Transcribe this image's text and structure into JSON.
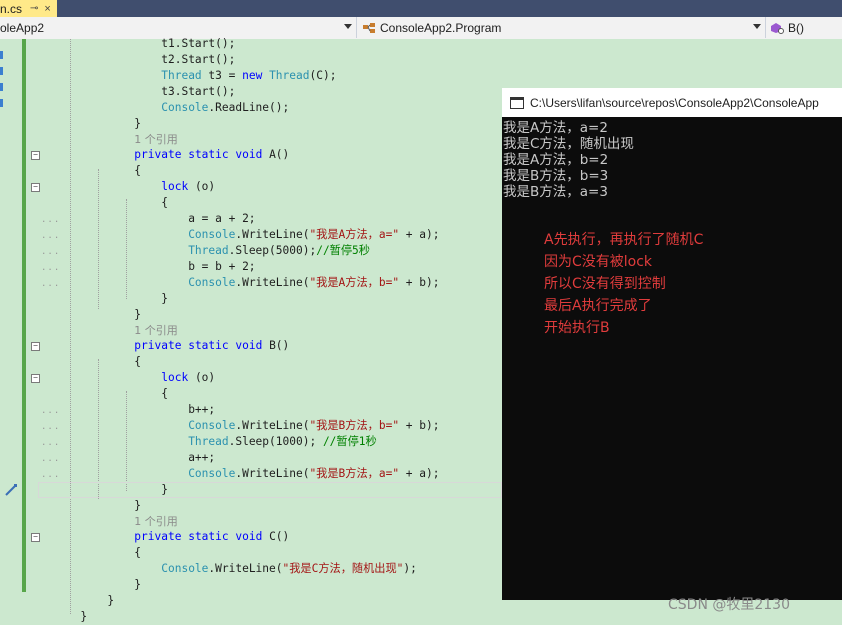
{
  "tab": {
    "label": "n.cs",
    "pin": "⊸",
    "close": "×"
  },
  "nav": {
    "project": "oleApp2",
    "class": "ConsoleApp2.Program",
    "member": "B()"
  },
  "code": {
    "t1_start": [
      "t1",
      ".",
      "Start",
      "();"
    ],
    "ref_label": "1 个引用",
    "lines": {
      "l1": "t1.Start();",
      "l2": "t2.Start();",
      "l4": "t3.Start();",
      "a_line1": "a = a + 2;",
      "b_line1": "b = b + 2;",
      "bpp": "b++;",
      "app": "a++;"
    },
    "strings": {
      "a_eq_a": "\"我是A方法，a=\"",
      "a_eq_b": "\"我是A方法，b=\"",
      "b_eq_b": "\"我是B方法，b=\"",
      "b_eq_a": "\"我是B方法，a=\"",
      "c_str": "\"我是C方法，随机出现\""
    },
    "comments": {
      "sleep5": "//暂停5秒",
      "sleep1": "//暂停1秒"
    },
    "sleep_a": "5000",
    "sleep_b": "1000"
  },
  "console": {
    "title": "C:\\Users\\lifan\\source\\repos\\ConsoleApp2\\ConsoleApp",
    "output": [
      "我是A方法，a=2",
      "我是C方法，随机出现",
      "我是A方法，b=2",
      "我是B方法，b=3",
      "我是B方法，a=3"
    ]
  },
  "annotation": [
    "A先执行，再执行了随机C",
    "因为C没有被lock",
    "所以C没有得到控制",
    "最后A执行完成了",
    "开始执行B"
  ],
  "watermark": "CSDN @牧里2130",
  "colors": {
    "editor_bg": "#cce8cf",
    "keyword": "#0000ff",
    "type": "#2b91af",
    "string": "#a31515",
    "comment": "#008000",
    "note": "#e03c3c",
    "console_bg": "#0c0c0c"
  }
}
